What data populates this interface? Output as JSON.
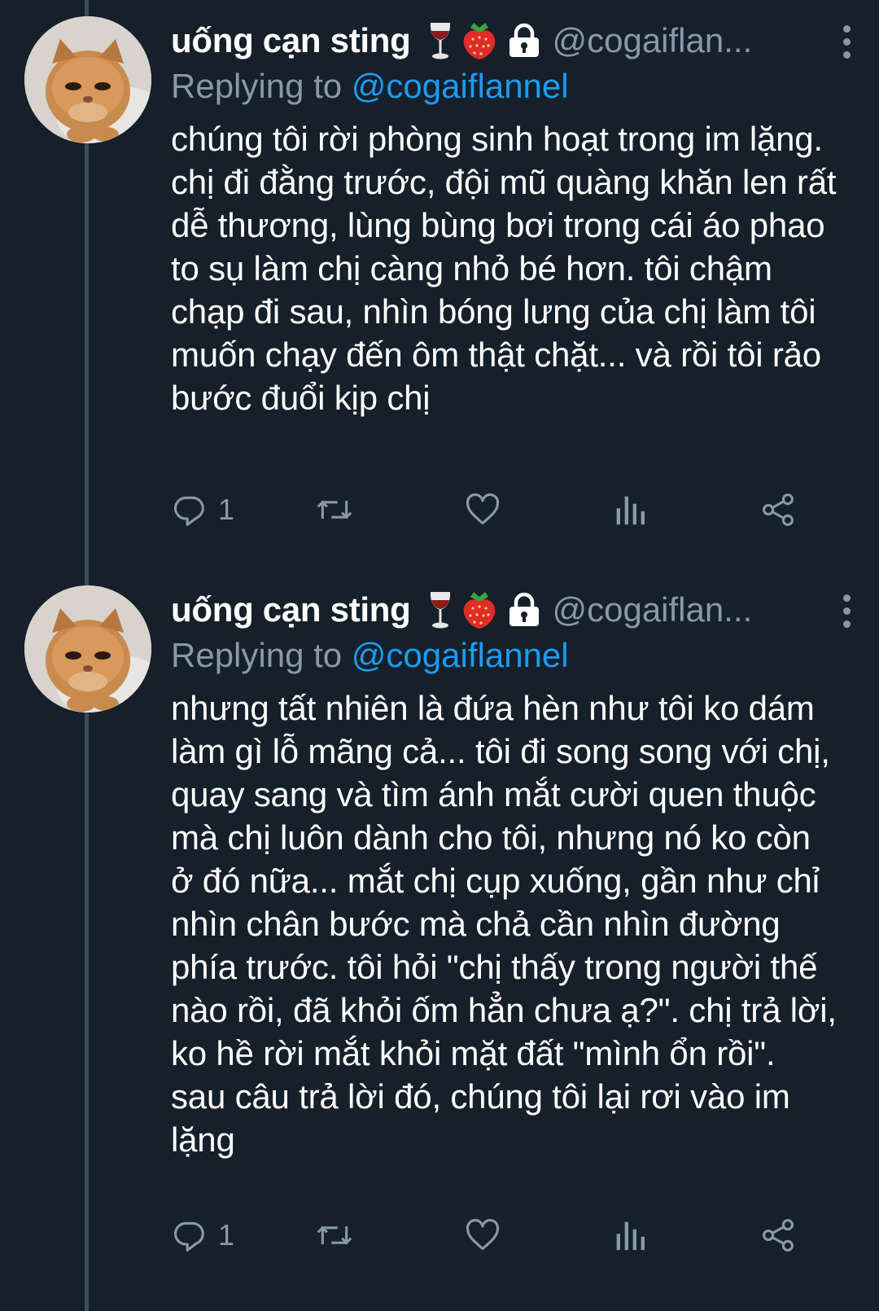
{
  "colors": {
    "background": "#15202b",
    "text": "#ffffff",
    "muted": "#8899a6",
    "accent": "#1d9bf0",
    "thread_line": "#3d4c5c"
  },
  "tweets": [
    {
      "author": {
        "display_name": "uống cạn sting",
        "emojis": [
          "wine-glass-icon",
          "strawberry-icon",
          "lock-icon"
        ],
        "handle": "@cogaiflan..."
      },
      "replying_prefix": "Replying to ",
      "replying_to": "@cogaiflannel",
      "text": "chúng tôi rời phòng sinh hoạt trong im lặng. chị đi đằng trước, đội mũ quàng khăn len rất dễ thương, lùng bùng bơi trong cái áo phao to sụ làm chị càng nhỏ bé hơn. tôi chậm chạp đi sau, nhìn bóng lưng của chị làm tôi muốn chạy đến ôm thật chặt... và rồi tôi rảo bước đuổi kịp chị",
      "reply_count": "1"
    },
    {
      "author": {
        "display_name": "uống cạn sting",
        "emojis": [
          "wine-glass-icon",
          "strawberry-icon",
          "lock-icon"
        ],
        "handle": "@cogaiflan..."
      },
      "replying_prefix": "Replying to ",
      "replying_to": "@cogaiflannel",
      "text": "nhưng tất nhiên là đứa hèn như tôi ko dám làm gì lỗ mãng cả... tôi đi song song với chị, quay sang và tìm ánh mắt cười quen thuộc mà chị luôn dành cho tôi, nhưng nó ko còn ở đó nữa... mắt chị cụp xuống, gần như chỉ nhìn chân bước mà chả cần nhìn đường phía trước. tôi hỏi \"chị thấy trong người thế nào rồi, đã khỏi ốm hẳn chưa ạ?\". chị trả lời, ko hề rời mắt khỏi mặt đất \"mình ổn rồi\". sau câu trả lời đó, chúng tôi lại rơi vào im lặng",
      "reply_count": "1"
    }
  ],
  "action_icons": [
    "reply-icon",
    "retweet-icon",
    "like-icon",
    "analytics-icon",
    "share-icon"
  ]
}
